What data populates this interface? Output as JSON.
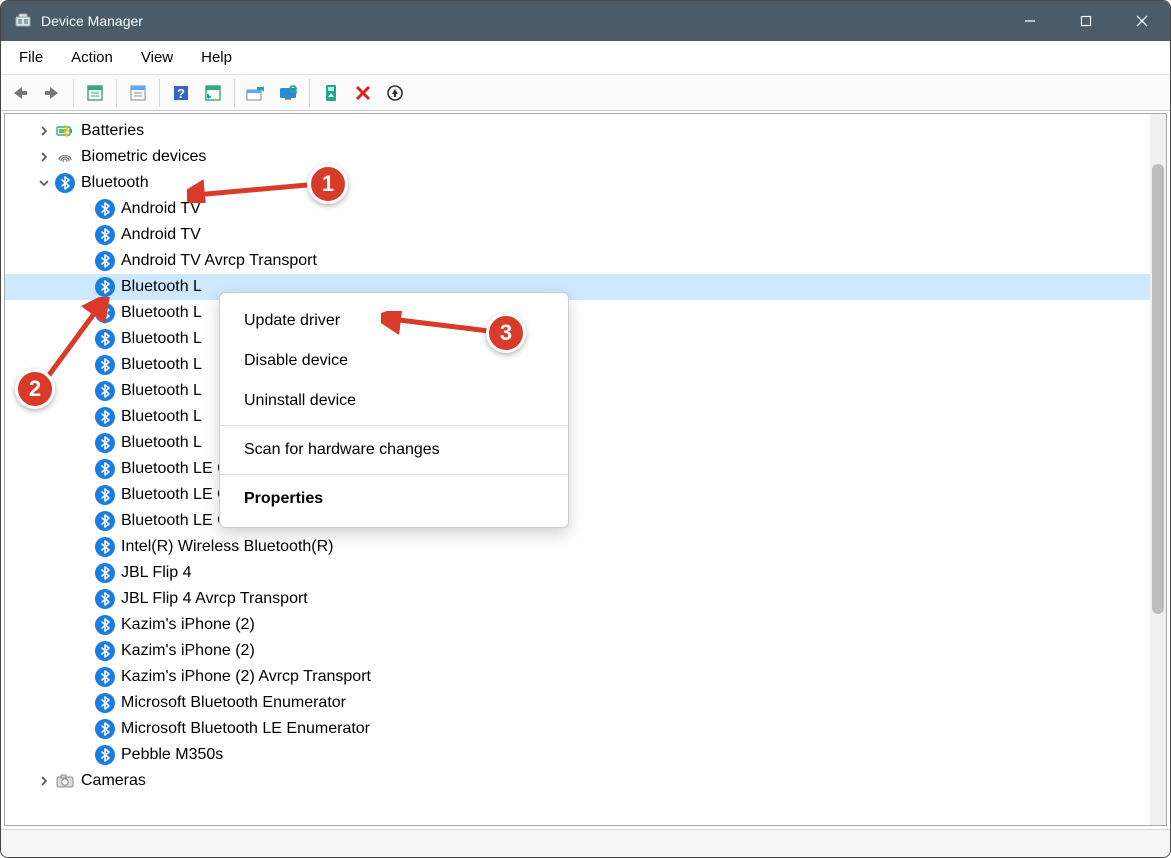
{
  "window": {
    "title": "Device Manager"
  },
  "menubar": {
    "items": [
      "File",
      "Action",
      "View",
      "Help"
    ]
  },
  "toolbar": {
    "buttons": [
      {
        "name": "back-icon"
      },
      {
        "name": "forward-icon"
      }
    ],
    "buttons2": [
      {
        "name": "show-hidden-icon"
      }
    ],
    "buttons3": [
      {
        "name": "properties-icon"
      }
    ],
    "buttons4": [
      {
        "name": "help-icon"
      },
      {
        "name": "refresh-icon"
      }
    ],
    "buttons5": [
      {
        "name": "update-driver-icon"
      },
      {
        "name": "scan-hardware-icon"
      }
    ],
    "buttons6": [
      {
        "name": "enable-icon"
      },
      {
        "name": "disable-icon"
      },
      {
        "name": "uninstall-icon"
      }
    ]
  },
  "tree": {
    "nodes": [
      {
        "label": "Batteries",
        "iconName": "battery-icon",
        "expandable": true,
        "expanded": false
      },
      {
        "label": "Biometric devices",
        "iconName": "fingerprint-icon",
        "expandable": true,
        "expanded": false
      },
      {
        "label": "Bluetooth",
        "iconName": "bluetooth-icon",
        "expandable": true,
        "expanded": true,
        "children": [
          "Android TV",
          "Android TV",
          "Android TV Avrcp Transport",
          "Bluetooth L",
          "Bluetooth L",
          "Bluetooth L",
          "Bluetooth L",
          "Bluetooth L",
          "Bluetooth L",
          "Bluetooth L",
          "Bluetooth LE Generic Attribute Service",
          "Bluetooth LE Generic Attribute Service",
          "Bluetooth LE Generic Attribute Service",
          "Intel(R) Wireless Bluetooth(R)",
          "JBL Flip 4",
          "JBL Flip 4 Avrcp Transport",
          "Kazim's iPhone (2)",
          "Kazim's iPhone (2)",
          "Kazim's iPhone (2) Avrcp Transport",
          "Microsoft Bluetooth Enumerator",
          "Microsoft Bluetooth LE Enumerator",
          "Pebble M350s"
        ],
        "selectedIndex": 3
      },
      {
        "label": "Cameras",
        "iconName": "camera-icon",
        "expandable": true,
        "expanded": false
      }
    ]
  },
  "contextMenu": {
    "items": [
      {
        "label": "Update driver",
        "type": "item"
      },
      {
        "label": "Disable device",
        "type": "item"
      },
      {
        "label": "Uninstall device",
        "type": "item"
      },
      {
        "type": "sep"
      },
      {
        "label": "Scan for hardware changes",
        "type": "item"
      },
      {
        "type": "sep"
      },
      {
        "label": "Properties",
        "type": "item",
        "bold": true
      }
    ]
  },
  "callouts": {
    "c1": "1",
    "c2": "2",
    "c3": "3"
  }
}
